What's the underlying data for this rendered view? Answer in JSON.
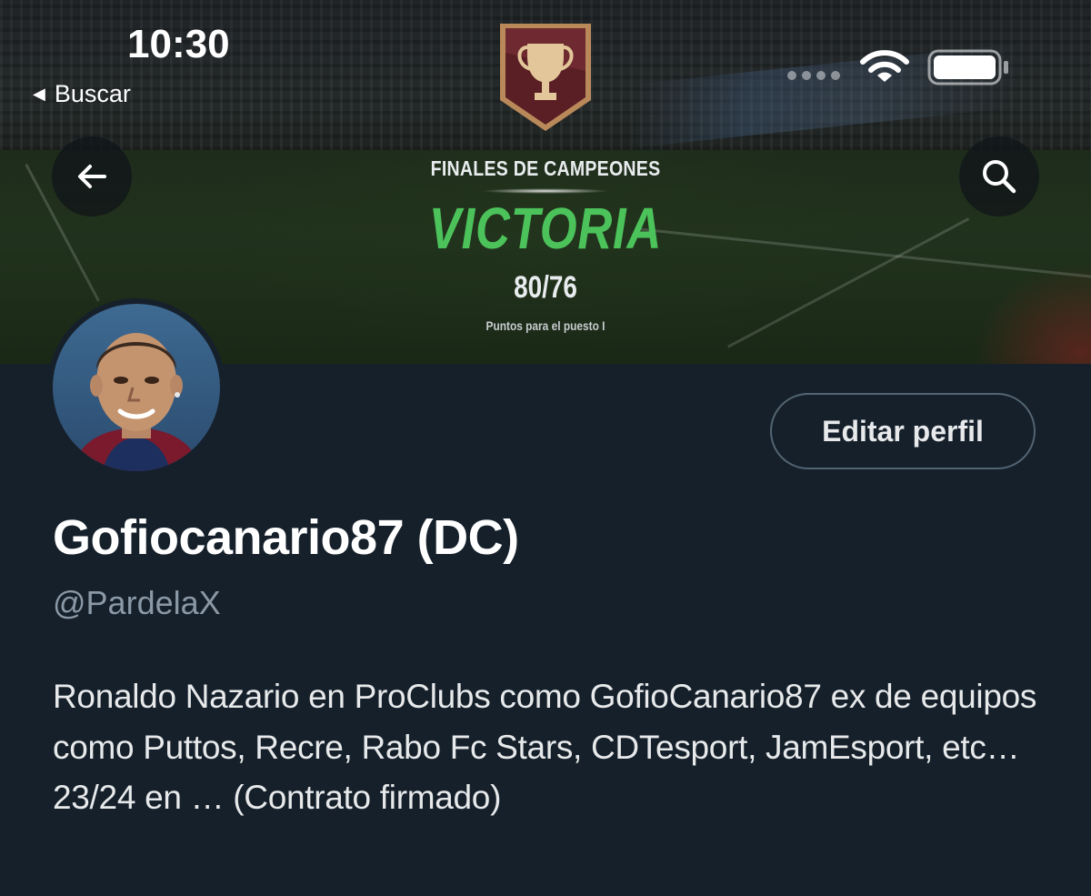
{
  "status_bar": {
    "time": "10:30",
    "back_app_label": "Buscar",
    "icons": [
      "wifi-icon",
      "battery-icon"
    ]
  },
  "header": {
    "back_icon": "arrow-left-icon",
    "search_icon": "search-icon"
  },
  "banner": {
    "title": "FINALES DE CAMPEONES",
    "result": "VICTORIA",
    "score": "80/76",
    "subtitle": "Puntos para el puesto I",
    "badge_icon": "trophy-icon",
    "result_color": "#4cc35a"
  },
  "profile": {
    "edit_button_label": "Editar perfil",
    "display_name": "Gofiocanario87 (DC)",
    "handle": "@PardelaX",
    "bio": "Ronaldo Nazario en ProClubs como GofioCanario87 ex de equipos como Puttos, Recre, Rabo Fc Stars, CDTesport, JamEsport, etc… 23/24 en … (Contrato firmado)"
  },
  "colors": {
    "background": "#15202b",
    "text_primary": "#e7e9ea",
    "text_secondary": "#8b98a5",
    "button_border": "#536471"
  }
}
